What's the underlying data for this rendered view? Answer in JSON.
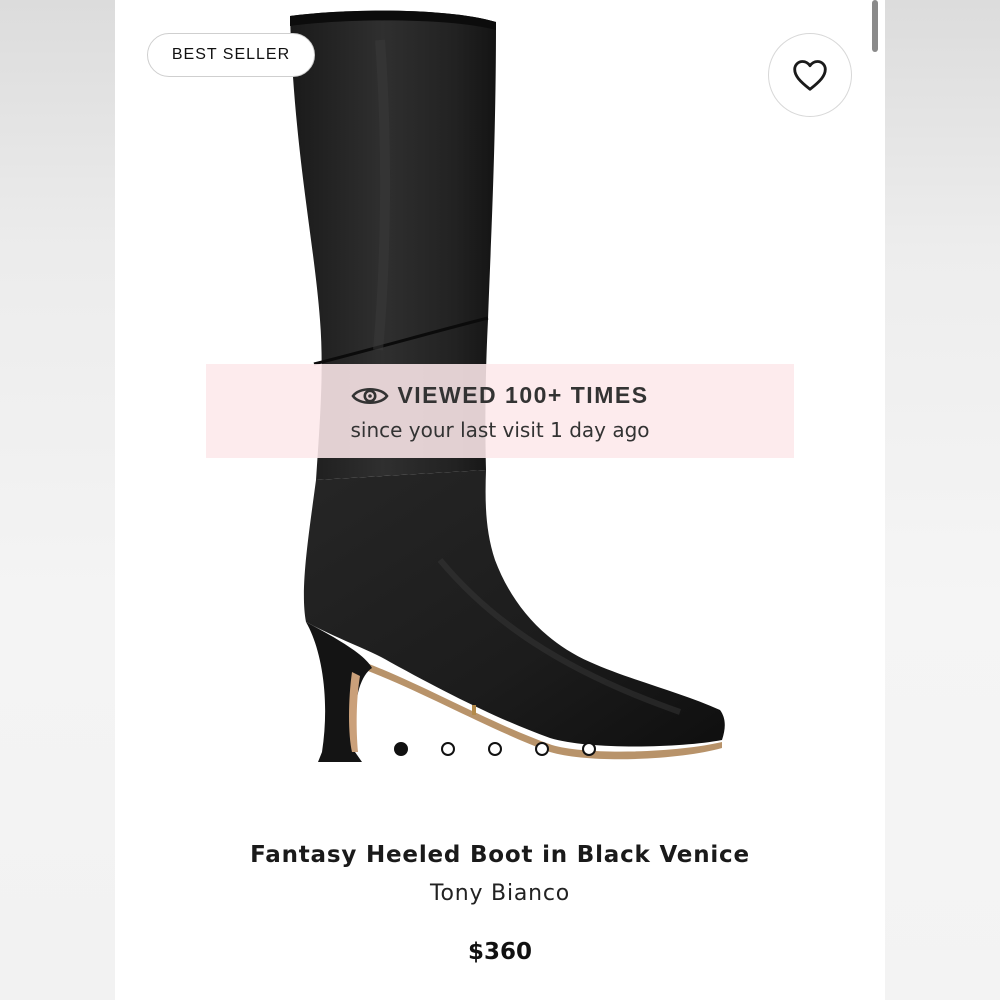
{
  "badge": {
    "label": "BEST SELLER"
  },
  "favorite": {
    "icon": "heart-outline-icon"
  },
  "product_image": {
    "alt": "Black leather knee-high boot with flared heel"
  },
  "viewed_banner": {
    "icon": "eye-icon",
    "title": "VIEWED 100+ TIMES",
    "subtitle": "since your last visit 1 day ago",
    "background": "#fde8ea"
  },
  "carousel": {
    "total": 5,
    "active_index": 0
  },
  "product": {
    "name": "Fantasy Heeled Boot in Black Venice",
    "brand": "Tony Bianco",
    "price": "$360"
  }
}
